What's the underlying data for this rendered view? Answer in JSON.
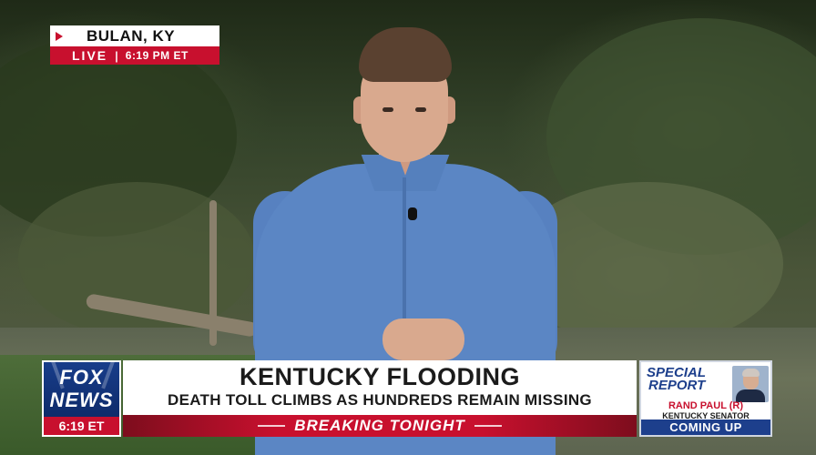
{
  "location_bug": {
    "location": "BULAN, KY",
    "live_label": "LIVE",
    "separator": "|",
    "time": "6:19 PM ET"
  },
  "network_logo": {
    "fox": "FOX",
    "news": "NEWS",
    "time": "6:19 ET"
  },
  "headline": {
    "title": "KENTUCKY FLOODING",
    "subtitle": "DEATH TOLL CLIMBS AS HUNDREDS REMAIN MISSING",
    "banner": "BREAKING TONIGHT"
  },
  "promo": {
    "special": "SPECIAL",
    "report": "REPORT",
    "name": "RAND PAUL (R)",
    "title": "KENTUCKY SENATOR",
    "coming_up": "COMING UP"
  },
  "colors": {
    "fox_red": "#c8102e",
    "fox_blue": "#1d3f8c",
    "shirt_blue": "#5b86c4"
  }
}
